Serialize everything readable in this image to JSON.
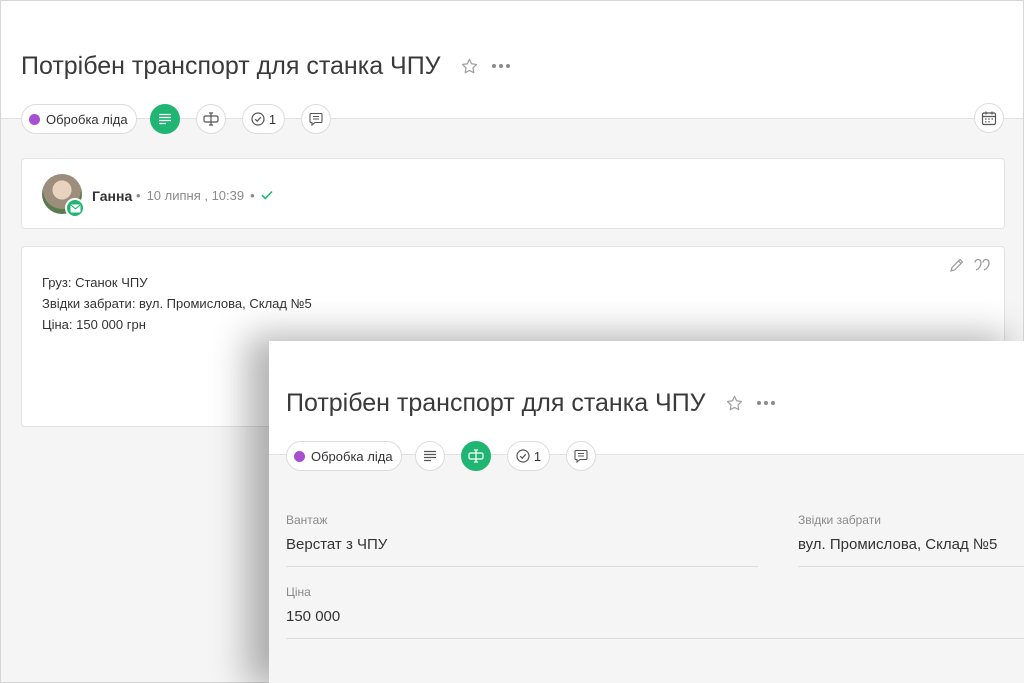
{
  "back_view": {
    "title": "Потрібен транспорт для станка ЧПУ",
    "stage_label": "Обробка ліда",
    "tasks_count": "1",
    "author": "Ганна",
    "time": "10 липня , 10:39",
    "note_lines": [
      "Груз: Станок ЧПУ",
      "Звідки забрати: вул. Промислова, Склад №5",
      "Ціна: 150 000 грн"
    ]
  },
  "front_view": {
    "title": "Потрібен транспорт для станка ЧПУ",
    "stage_label": "Обробка ліда",
    "tasks_count": "1",
    "fields": {
      "cargo_label": "Вантаж",
      "cargo_value": "Верстат з ЧПУ",
      "pickup_label": "Звідки забрати",
      "pickup_value": "вул. Промислова, Склад №5",
      "price_label": "Ціна",
      "price_value": "150 000"
    }
  },
  "colors": {
    "accent_green": "#21b573",
    "stage_dot": "#a64fd1",
    "background": "#f5f5f5"
  },
  "icons": [
    "star-icon",
    "more-icon",
    "text-lines-icon",
    "field-cursor-icon",
    "check-circle-icon",
    "chat-icon",
    "calendar-icon",
    "email-icon",
    "check-icon",
    "pencil-icon",
    "quote-icon"
  ]
}
